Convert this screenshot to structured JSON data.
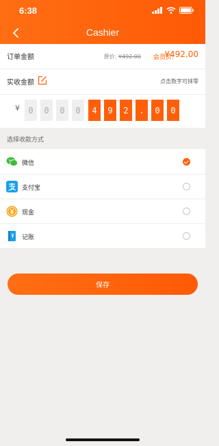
{
  "status": {
    "time": "6:38"
  },
  "nav": {
    "title": "Cashier"
  },
  "order": {
    "label": "订单金额",
    "original_prefix": "原价: ",
    "original_price": "¥492.00",
    "member_prefix": "会员价: ",
    "member_price": "¥492.00"
  },
  "actual": {
    "label": "实收金额",
    "hint": "点击数字可抹零"
  },
  "amount": {
    "currency": "¥",
    "digits": [
      "0",
      "0",
      "0",
      "0",
      "4",
      "9",
      "2",
      ".",
      "0",
      "0"
    ]
  },
  "payment": {
    "section_title": "选择收款方式",
    "methods": [
      {
        "label": "微信",
        "icon": "wechat-icon",
        "selected": true
      },
      {
        "label": "支付宝",
        "icon": "alipay-icon",
        "selected": false
      },
      {
        "label": "现金",
        "icon": "cash-icon",
        "selected": false
      },
      {
        "label": "记账",
        "icon": "ledger-icon",
        "selected": false
      }
    ]
  },
  "save_label": "保存",
  "colors": {
    "accent": "#ff5f0a",
    "wechat": "#3dbb3a",
    "alipay": "#1aa0e8",
    "cash": "#f5a623"
  }
}
